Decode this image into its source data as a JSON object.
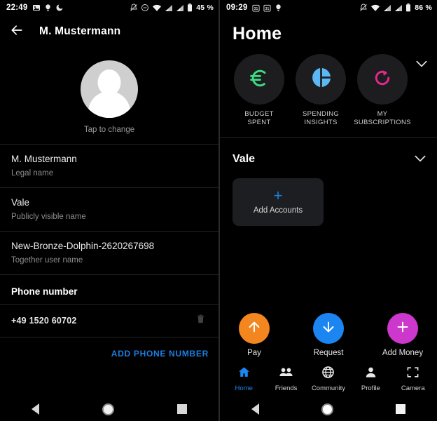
{
  "left": {
    "statusbar": {
      "clock": "22:49",
      "left_icons": [
        "image-icon",
        "lightbulb-icon",
        "dnd-moon-icon"
      ],
      "right_icons": [
        "notifications-off-icon",
        "do-not-disturb-icon",
        "wifi-icon",
        "signal-sim1-icon",
        "signal-sim2-icon",
        "battery-icon"
      ],
      "battery": "45 %"
    },
    "appbar": {
      "back_icon": "arrow-back-icon",
      "title": "M. Mustermann"
    },
    "avatar": {
      "icon": "person-avatar-icon",
      "caption": "Tap to change"
    },
    "rows": [
      {
        "title": "M. Mustermann",
        "subtitle": "Legal name"
      },
      {
        "title": "Vale",
        "subtitle": "Publicly visible name"
      },
      {
        "title": "New-Bronze-Dolphin-2620267698",
        "subtitle": "Together user name"
      }
    ],
    "phone_section": {
      "heading": "Phone number",
      "number": "+49 1520 60702",
      "delete_icon": "trash-icon",
      "add_label": "ADD PHONE NUMBER",
      "add_color": "#1b7fe0"
    }
  },
  "right": {
    "statusbar": {
      "clock": "09:29",
      "left_icons": [
        "calendar-31-icon",
        "calendar-31-icon",
        "lightbulb-icon"
      ],
      "right_icons": [
        "notifications-off-icon",
        "wifi-icon",
        "signal-sim1-icon",
        "signal-sim2-icon",
        "battery-icon"
      ],
      "battery": "86 %"
    },
    "title": "Home",
    "quick_actions": {
      "expand_icon": "chevron-down-icon",
      "items": [
        {
          "icon": "euro-icon",
          "color": "#3ddc84",
          "label": "BUDGET\nSPENT",
          "line1": "BUDGET",
          "line2": "SPENT"
        },
        {
          "icon": "pie-chart-icon",
          "color": "#5cb8f5",
          "label": "SPENDING\nINSIGHTS",
          "line1": "SPENDING",
          "line2": "INSIGHTS"
        },
        {
          "icon": "refresh-subscription-icon",
          "color": "#e8278f",
          "label": "MY\nSUBSCRIPTIONS",
          "line1": "MY",
          "line2": "SUBSCRIPTIONS"
        }
      ]
    },
    "accounts": {
      "name": "Vale",
      "expand_icon": "chevron-down-icon",
      "add_card": {
        "icon": "plus-icon",
        "label": "Add Accounts",
        "color": "#1a82e2"
      }
    },
    "actions": [
      {
        "icon": "arrow-up-icon",
        "label": "Pay",
        "color": "#f4861f"
      },
      {
        "icon": "arrow-down-icon",
        "label": "Request",
        "color": "#1b86f2"
      },
      {
        "icon": "plus-icon",
        "label": "Add Money",
        "color": "#cc37cc"
      }
    ],
    "bottom_nav": [
      {
        "icon": "home-icon",
        "label": "Home",
        "active": true
      },
      {
        "icon": "friends-icon",
        "label": "Friends",
        "active": false
      },
      {
        "icon": "globe-icon",
        "label": "Community",
        "active": false
      },
      {
        "icon": "person-icon",
        "label": "Profile",
        "active": false
      },
      {
        "icon": "camera-frame-icon",
        "label": "Camera",
        "active": false
      }
    ]
  },
  "android_nav": {
    "back": "back-triangle-icon",
    "home": "home-circle-icon",
    "recents": "recents-square-icon"
  }
}
